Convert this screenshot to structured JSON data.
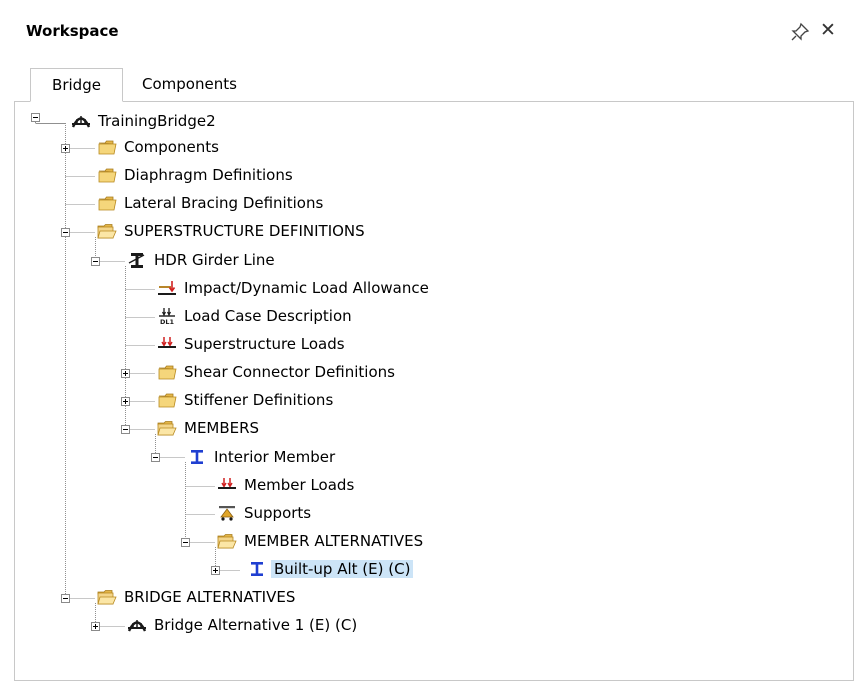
{
  "panel": {
    "title": "Workspace"
  },
  "tabs": [
    {
      "label": "Bridge",
      "active": true
    },
    {
      "label": "Components",
      "active": false
    }
  ],
  "tree": [
    {
      "id": "n0",
      "label": "TrainingBridge2",
      "icon": "bridge-icon",
      "expander": "minus"
    },
    {
      "id": "n1",
      "label": "Components",
      "icon": "folder-closed-icon",
      "expander": "plus"
    },
    {
      "id": "n2",
      "label": "Diaphragm Definitions",
      "icon": "folder-closed-icon",
      "expander": "none"
    },
    {
      "id": "n3",
      "label": "Lateral Bracing Definitions",
      "icon": "folder-closed-icon",
      "expander": "none"
    },
    {
      "id": "n4",
      "label": "SUPERSTRUCTURE DEFINITIONS",
      "icon": "folder-open-icon",
      "expander": "minus"
    },
    {
      "id": "n5",
      "label": "HDR Girder Line",
      "icon": "girder-line-icon",
      "expander": "minus"
    },
    {
      "id": "n6",
      "label": "Impact/Dynamic Load Allowance",
      "icon": "impact-load-icon",
      "expander": "none"
    },
    {
      "id": "n7",
      "label": "Load Case Description",
      "icon": "load-case-icon",
      "expander": "none"
    },
    {
      "id": "n8",
      "label": "Superstructure Loads",
      "icon": "loads-icon",
      "expander": "none"
    },
    {
      "id": "n9",
      "label": "Shear Connector Definitions",
      "icon": "folder-closed-icon",
      "expander": "plus"
    },
    {
      "id": "n10",
      "label": "Stiffener Definitions",
      "icon": "folder-closed-icon",
      "expander": "plus"
    },
    {
      "id": "n11",
      "label": "MEMBERS",
      "icon": "folder-open-icon",
      "expander": "minus"
    },
    {
      "id": "n12",
      "label": "Interior Member",
      "icon": "i-beam-icon",
      "expander": "minus"
    },
    {
      "id": "n13",
      "label": "Member Loads",
      "icon": "loads-icon",
      "expander": "none"
    },
    {
      "id": "n14",
      "label": "Supports",
      "icon": "support-icon",
      "expander": "none"
    },
    {
      "id": "n15",
      "label": "MEMBER ALTERNATIVES",
      "icon": "folder-open-icon",
      "expander": "minus"
    },
    {
      "id": "n16",
      "label": "Built-up Alt (E) (C)",
      "icon": "i-beam-icon",
      "expander": "plus",
      "selected": true
    },
    {
      "id": "n17",
      "label": "BRIDGE ALTERNATIVES",
      "icon": "folder-open-icon",
      "expander": "minus"
    },
    {
      "id": "n18",
      "label": "Bridge Alternative 1 (E) (C)",
      "icon": "bridge-icon",
      "expander": "plus"
    }
  ]
}
